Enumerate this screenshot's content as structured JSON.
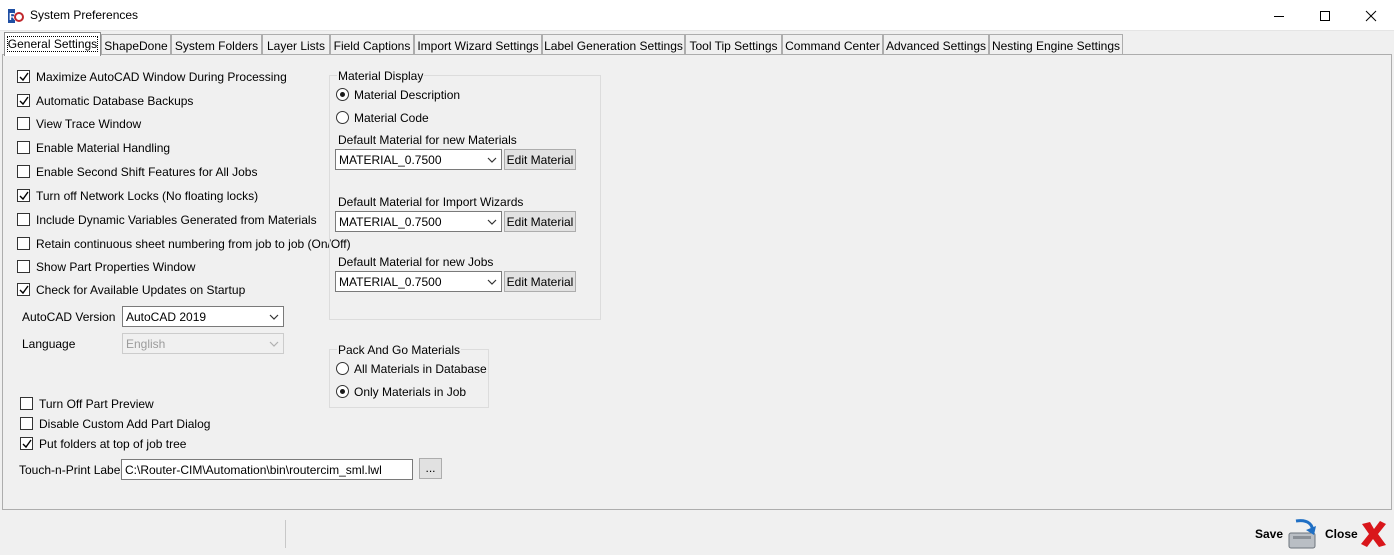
{
  "window": {
    "title": "System Preferences"
  },
  "tabs": [
    {
      "label": "General Settings"
    },
    {
      "label": "ShapeDone"
    },
    {
      "label": "System Folders"
    },
    {
      "label": "Layer Lists"
    },
    {
      "label": "Field Captions"
    },
    {
      "label": "Import Wizard Settings"
    },
    {
      "label": "Label Generation Settings"
    },
    {
      "label": "Tool Tip Settings"
    },
    {
      "label": "Command Center"
    },
    {
      "label": "Advanced Settings"
    },
    {
      "label": "Nesting Engine Settings"
    }
  ],
  "general": {
    "checkboxes": [
      {
        "label": "Maximize AutoCAD Window During Processing",
        "checked": true
      },
      {
        "label": "Automatic Database Backups",
        "checked": true
      },
      {
        "label": "View Trace Window",
        "checked": false
      },
      {
        "label": "Enable Material Handling",
        "checked": false
      },
      {
        "label": "Enable Second Shift Features for All Jobs",
        "checked": false
      },
      {
        "label": "Turn off Network Locks (No floating locks)",
        "checked": true
      },
      {
        "label": "Include Dynamic Variables Generated from Materials",
        "checked": false
      },
      {
        "label": "Retain continuous sheet numbering from job to job (On/Off)",
        "checked": false
      },
      {
        "label": "Show Part Properties Window",
        "checked": false
      },
      {
        "label": "Check for Available Updates on Startup",
        "checked": true
      }
    ],
    "autocad_version": {
      "label": "AutoCAD Version",
      "value": "AutoCAD 2019"
    },
    "language": {
      "label": "Language",
      "value": "English"
    },
    "lower_checkboxes": [
      {
        "label": "Turn Off Part Preview",
        "checked": false
      },
      {
        "label": "Disable Custom Add Part Dialog",
        "checked": false
      },
      {
        "label": "Put folders at top of job tree",
        "checked": true
      }
    ],
    "touch_print": {
      "label": "Touch-n-Print Label",
      "value": "C:\\Router-CIM\\Automation\\bin\\routercim_sml.lwl",
      "browse": "..."
    }
  },
  "material_display": {
    "title": "Material Display",
    "options": [
      {
        "label": "Material Description",
        "selected": true
      },
      {
        "label": "Material Code",
        "selected": false
      }
    ],
    "defaults": [
      {
        "label": "Default Material for new Materials",
        "value": "MATERIAL_0.7500",
        "button": "Edit Material"
      },
      {
        "label": "Default Material for Import Wizards",
        "value": "MATERIAL_0.7500",
        "button": "Edit Material"
      },
      {
        "label": "Default Material for new Jobs",
        "value": "MATERIAL_0.7500",
        "button": "Edit Material"
      }
    ]
  },
  "pack_and_go": {
    "title": "Pack And Go Materials",
    "options": [
      {
        "label": "All Materials in Database",
        "selected": false
      },
      {
        "label": "Only Materials in Job",
        "selected": true
      }
    ]
  },
  "footer": {
    "save_label": "Save",
    "close_label": "Close"
  },
  "colors": {
    "close_x": "#d9161b",
    "accent": "#0078d7"
  }
}
